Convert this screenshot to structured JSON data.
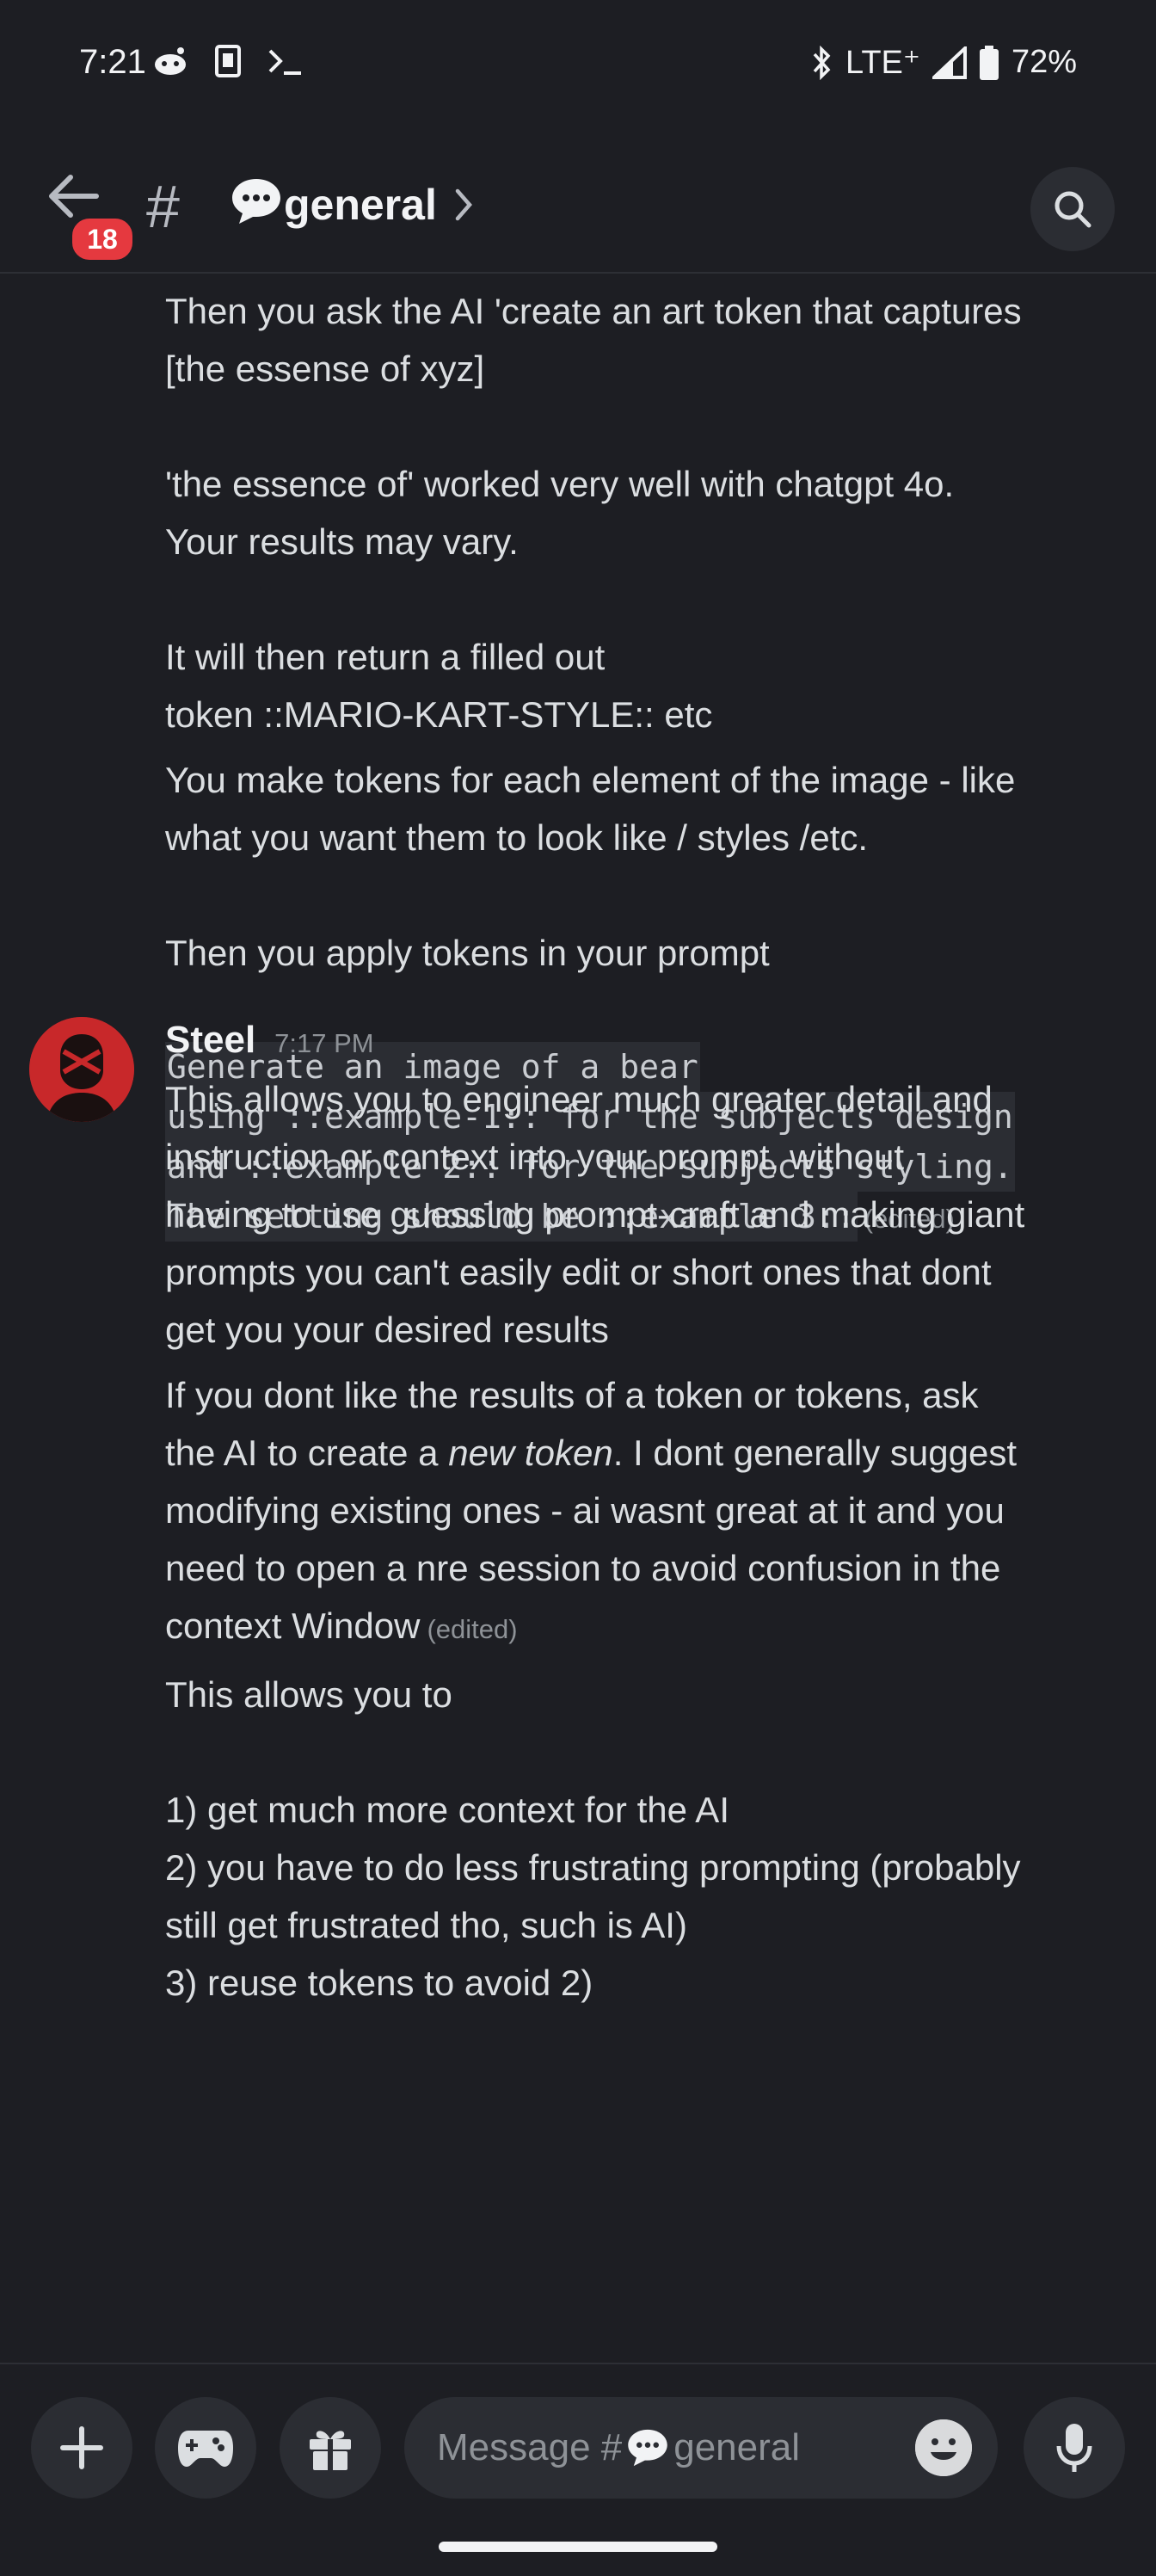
{
  "status_bar": {
    "time": "7:21",
    "network": "LTE⁺",
    "battery": "72%"
  },
  "header": {
    "badge_count": "18",
    "channel_name": "general"
  },
  "messages": {
    "continued_lines": [
      "Then you ask the AI 'create an art token that captures",
      "[the essense of xyz]",
      "'the essence of' worked very well with chatgpt 4o.",
      "Your results may vary.",
      "It will then return a filled out",
      "token ::MARIO-KART-STYLE:: etc",
      "You make tokens for each element of the image - like",
      "what you want them to look like / styles /etc.",
      "Then you apply tokens in your prompt"
    ],
    "code_lines": [
      "Generate an image of a bear",
      "using ::example-1:: for the subjects design",
      "and ::example 2:: for the subjects styling.",
      "The setting should be ::example 3::"
    ],
    "edited_label": "(edited)",
    "author": "Steel",
    "timestamp": "7:17 PM",
    "steel_msg1": [
      "This allows you to engineer much greater detail and",
      "instruction or context into your prompt, without",
      "having to use guessing prompt-craft and making giant",
      "prompts you can't easily edit or short ones that dont",
      "get you your desired results"
    ],
    "steel_msg2": {
      "line1": "If you dont like the results of a token or tokens, ask",
      "line2_before": "the AI to create a ",
      "line2_emphasis": "new token",
      "line2_after": ". I dont generally suggest",
      "line3": "modifying existing ones - ai wasnt great at it and you",
      "line4": "need to open a nre session to avoid confusion in the",
      "line5": "context Window"
    },
    "steel_msg3": [
      "This allows you to",
      "1) get much more context for the AI",
      "2) you have to do less frustrating prompting (probably",
      "still get frustrated tho, such is AI)",
      "3) reuse tokens to avoid 2)"
    ]
  },
  "composer": {
    "placeholder_prefix": "Message #",
    "placeholder_channel": "general"
  },
  "icons": [
    "back-arrow-icon",
    "hash-icon",
    "speech-bubble-icon",
    "chevron-right-icon",
    "search-icon",
    "plus-icon",
    "gamepad-icon",
    "gift-icon",
    "emoji-icon",
    "microphone-icon"
  ],
  "colors": {
    "background": "#1d1e23",
    "badge": "#e5393f",
    "avatar": "#c8282a"
  }
}
